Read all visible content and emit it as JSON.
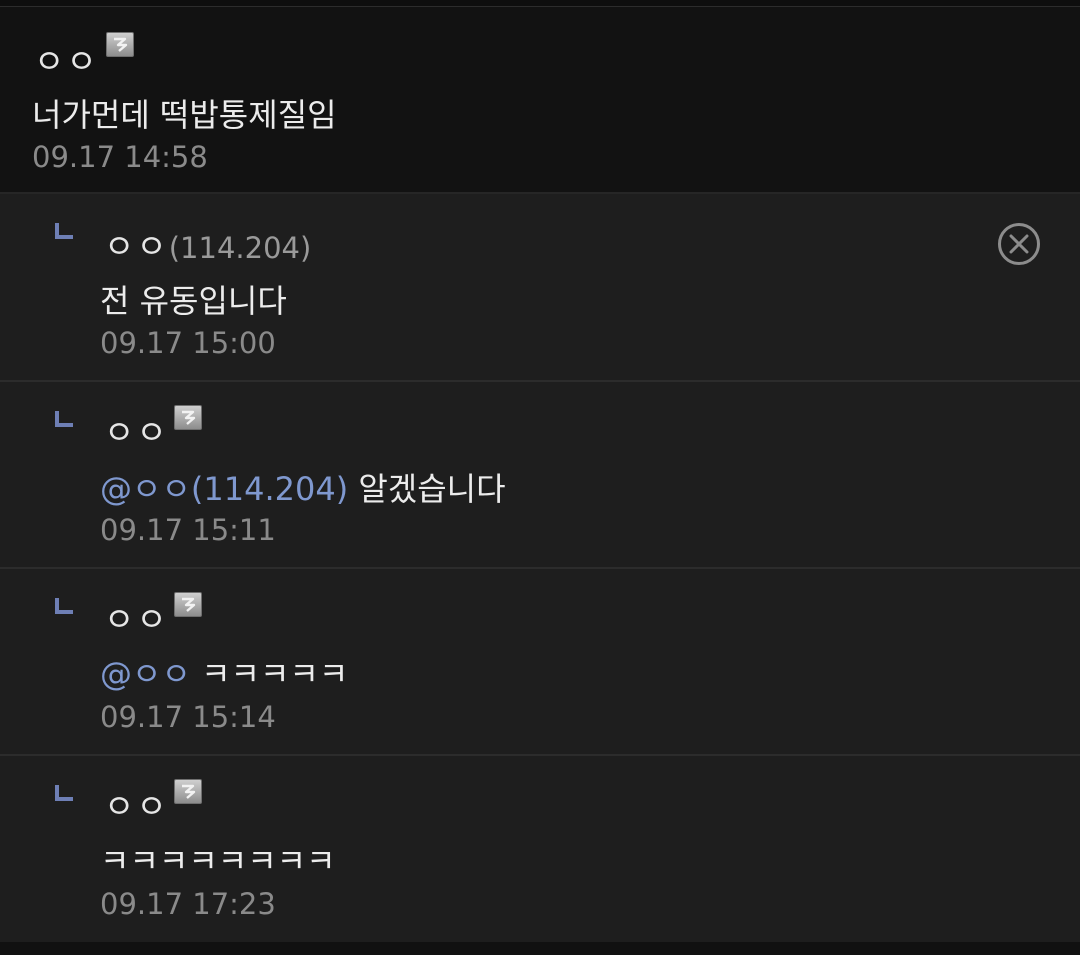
{
  "main_comment": {
    "nick": "ㅇㅇ",
    "text": "너가먼데 떡밥통제질임",
    "time": "09.17 14:58"
  },
  "replies": [
    {
      "nick": "ㅇㅇ",
      "ip": "(114.204)",
      "text": "전 유동입니다",
      "time": "09.17 15:00"
    },
    {
      "nick": "ㅇㅇ",
      "mention": "@ㅇㅇ(114.204)",
      "text": " 알겠습니다",
      "time": "09.17 15:11"
    },
    {
      "nick": "ㅇㅇ",
      "mention": "@ㅇㅇ",
      "text": " ㅋㅋㅋㅋㅋ",
      "time": "09.17 15:14"
    },
    {
      "nick": "ㅇㅇ",
      "text": "ㅋㅋㅋㅋㅋㅋㅋㅋ",
      "time": "09.17 17:23"
    }
  ],
  "colors": {
    "mention": "#7f98cf",
    "reply_arrow": "#6e7fb5",
    "background_main": "#121212",
    "background_reply": "#1e1e1e"
  },
  "icons": {
    "fixed_nick_badge": "fixed-nick-badge-icon",
    "reply_arrow": "reply-arrow-icon",
    "delete": "close-circle-icon"
  }
}
